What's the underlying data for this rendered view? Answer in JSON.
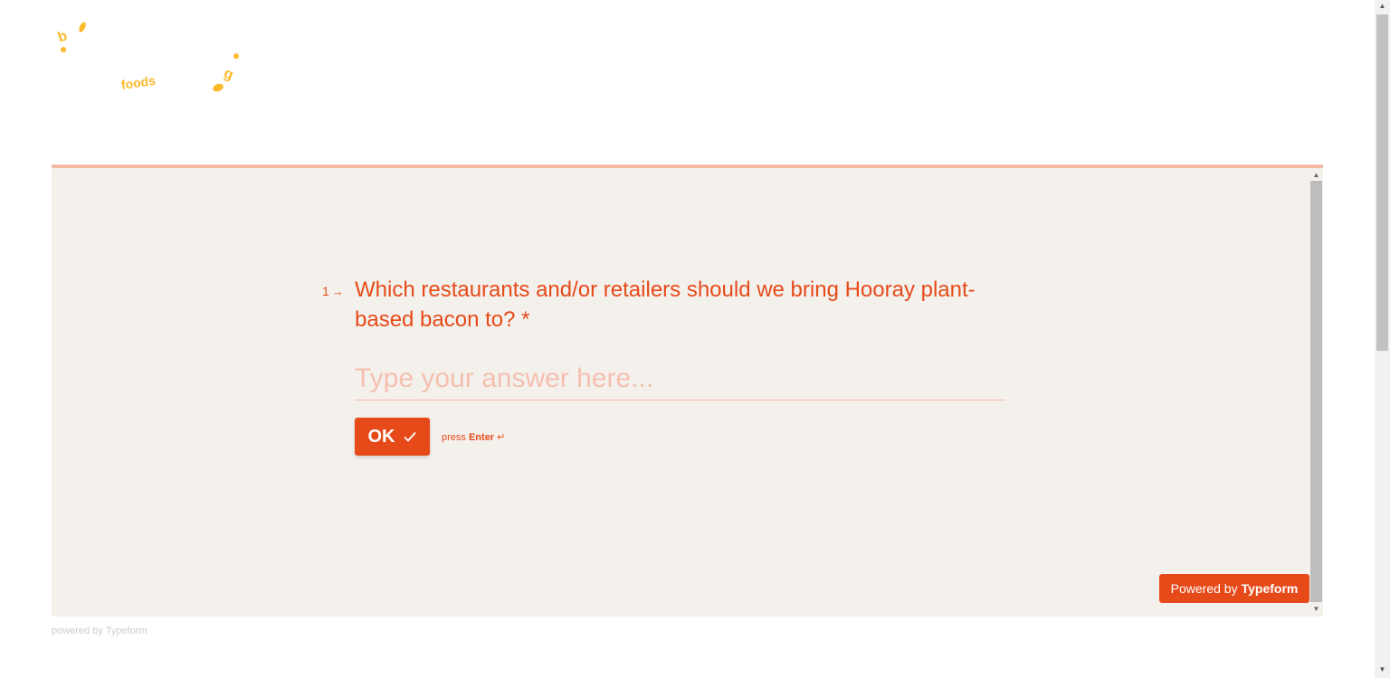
{
  "logo": {
    "text": "foods",
    "color": "#fbb92c"
  },
  "form": {
    "question_number": "1",
    "question_arrow": "→",
    "question_text": "Which restaurants and/or retailers should we bring Hooray plant-based bacon to? *",
    "answer_placeholder": "Type your answer here...",
    "answer_value": "",
    "ok_label": "OK",
    "hint_press": "press",
    "hint_key": "Enter",
    "hint_symbol": "↵",
    "progress_fraction": 1.0,
    "accent_color": "#e64a19",
    "background_color": "#f4f1ed"
  },
  "badge": {
    "prefix": "Powered by",
    "brand": "Typeform"
  },
  "footer": {
    "text": "powered by Typeform"
  },
  "icons": {
    "check": "check-icon",
    "arrow": "arrow-right-icon",
    "enter": "enter-icon"
  }
}
